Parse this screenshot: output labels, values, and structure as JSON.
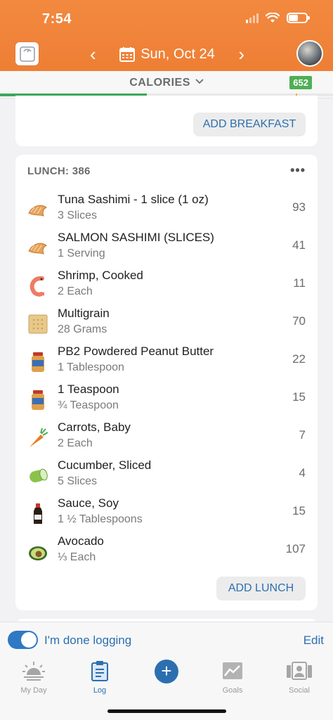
{
  "status": {
    "time": "7:54"
  },
  "header": {
    "date": "Sun, Oct 24",
    "icons": {
      "left": "scale-icon",
      "calendar": "calendar-icon",
      "prev": "chevron-left-icon",
      "next": "chevron-right-icon"
    },
    "accent": "#ee7f35"
  },
  "calories": {
    "label": "CALORIES",
    "remaining_badge": "652",
    "progress_fraction": 0.44,
    "badge_color": "#4fae55"
  },
  "breakfast": {
    "add_label": "ADD BREAKFAST"
  },
  "lunch": {
    "title": "LUNCH: 386",
    "more": "•••",
    "add_label": "ADD LUNCH",
    "items": [
      {
        "name": "Tuna Sashimi - 1 slice (1 oz)",
        "serving": "3 Slices",
        "calories": "93",
        "icon": "fish-icon"
      },
      {
        "name": "SALMON SASHIMI (SLICES)",
        "serving": "1 Serving",
        "calories": "41",
        "icon": "fish-icon"
      },
      {
        "name": "Shrimp, Cooked",
        "serving": "2 Each",
        "calories": "11",
        "icon": "shrimp-icon"
      },
      {
        "name": "Multigrain",
        "serving": "28 Grams",
        "calories": "70",
        "icon": "cracker-icon"
      },
      {
        "name": "PB2 Powdered Peanut Butter",
        "serving": "1 Tablespoon",
        "calories": "22",
        "icon": "jar-icon"
      },
      {
        "name": "1 Teaspoon",
        "serving": "¾ Teaspoon",
        "calories": "15",
        "icon": "jar-icon"
      },
      {
        "name": "Carrots, Baby",
        "serving": "2 Each",
        "calories": "7",
        "icon": "carrot-icon"
      },
      {
        "name": "Cucumber, Sliced",
        "serving": "5 Slices",
        "calories": "4",
        "icon": "cucumber-icon"
      },
      {
        "name": "Sauce, Soy",
        "serving": "1 ½ Tablespoons",
        "calories": "15",
        "icon": "bottle-icon"
      },
      {
        "name": "Avocado",
        "serving": "⅓ Each",
        "calories": "107",
        "icon": "avocado-icon"
      }
    ]
  },
  "footer": {
    "done_label": "I'm done logging",
    "done_toggle_on": true,
    "edit_label": "Edit"
  },
  "tabs": [
    {
      "label": "My Day",
      "icon": "sunrise-icon"
    },
    {
      "label": "Log",
      "icon": "clipboard-icon",
      "active": true
    },
    {
      "label": "",
      "icon": "plus-icon"
    },
    {
      "label": "Goals",
      "icon": "chart-icon"
    },
    {
      "label": "Social",
      "icon": "people-icon"
    }
  ]
}
